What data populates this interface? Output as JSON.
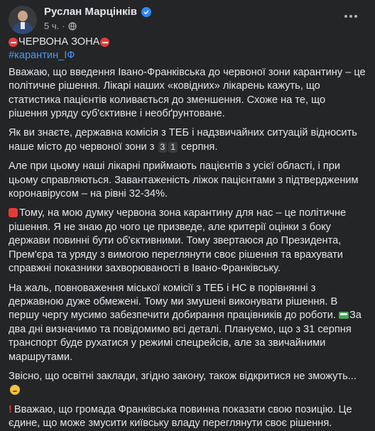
{
  "post": {
    "author": "Руслан Марцінків",
    "time": "5 ч.",
    "title": "ЧЕРВОНА ЗОНА",
    "hashtag": "#карантин_ІФ",
    "p1": "Вважаю, що введення Івано-Франківська до червоної зони карантину – це політичне рішення. Лікарі наших «ковідних» лікарень кажуть, що статистика пацієнтів коливається до зменшення. Схоже на те, що рішення уряду суб'єктивне і необґрунтоване.",
    "p2_a": "Як ви знаєте, державна комісія з ТЕБ і надзвичайних ситуацій відносить наше місто до червоної зони з",
    "p2_d1": "3",
    "p2_d2": "1",
    "p2_b": "серпня.",
    "p3": "Але при цьому наші лікарні приймають пацієнтів з усієї області, і при цьому справляються. Завантаженість ліжок пацієнтами з підтвердженим коронавірусом – на рівні 32-34%.",
    "p4": "Тому, на мою думку червона зона карантину для нас – це політичне рішення. Я не знаю до чого це призведе, але критерії оцінки з боку держави повинні бути об'єктивними. Тому звертаюся до Президента, Прем'єра та уряду з вимогою переглянути своє рішення та врахувати справжні показники захворюваності в Івано-Франківську.",
    "p5_a": "На жаль, повноваження міської комісії з ТЕБ і НС в порівнянні з державною дуже обмежені. Тому ми змушені виконувати рішення. В першу чергу мусимо забезпечити добирання працівників до роботи.",
    "p5_b": "За два дні визначимо та повідомимо всі деталі. Плануємо, що з 31 серпня транспорт буде рухатися у режимі спецрейсів, але за звичайними маршрутами.",
    "p6": "Звісно, що освітні заклади, згідно закону, також відкритися не зможуть...",
    "p7": "Вважаю, що громада Франківська повинна показати свою позицію. Це єдине, що може змусити київську владу переглянути своє рішення."
  },
  "icons": {
    "verified": "verified-badge-icon",
    "globe": "globe-icon",
    "more": "more-options-icon"
  },
  "colors": {
    "background": "#242526",
    "text": "#e4e6eb",
    "muted": "#b0b3b8",
    "link": "#4599ff",
    "verified": "#2d88ff",
    "red": "#e53b3b"
  }
}
